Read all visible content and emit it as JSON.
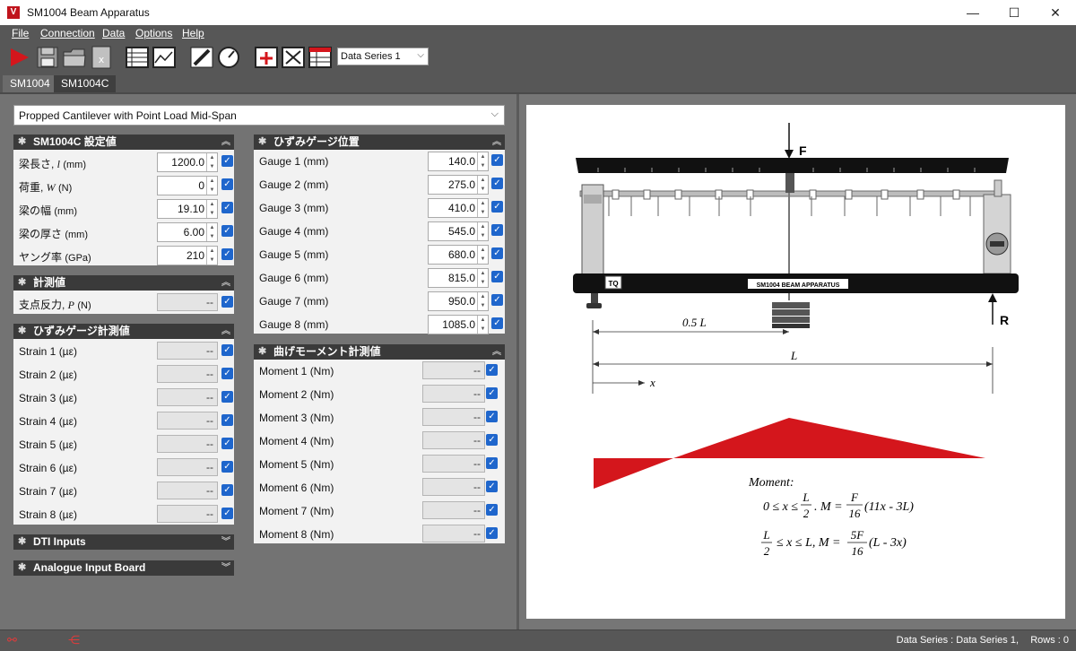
{
  "window": {
    "title": "SM1004 Beam Apparatus",
    "minimize": "—",
    "maximize": "☐",
    "close": "✕"
  },
  "menu": [
    "File",
    "Connection",
    "Data",
    "Options",
    "Help"
  ],
  "toolbar": {
    "series_select": "Data Series 1"
  },
  "tabs": [
    "SM1004",
    "SM1004C"
  ],
  "active_tab": "SM1004C",
  "config_select": "Propped Cantilever with Point Load Mid-Span",
  "settings": {
    "title": "SM1004C 設定値",
    "rows": [
      {
        "label": "梁長さ, ",
        "sym": "l",
        "unit": "(mm)",
        "value": "1200.0"
      },
      {
        "label": "荷重, ",
        "sym": "W",
        "unit": "(N)",
        "value": "0"
      },
      {
        "label": "梁の幅 ",
        "sym": "",
        "unit": "(mm)",
        "value": "19.10"
      },
      {
        "label": "梁の厚さ ",
        "sym": "",
        "unit": "(mm)",
        "value": "6.00"
      },
      {
        "label": "ヤング率 ",
        "sym": "",
        "unit": "(GPa)",
        "value": "210"
      }
    ]
  },
  "measured": {
    "title": "計測値",
    "rows": [
      {
        "label": "支点反力, ",
        "sym": "P",
        "unit": "(N)",
        "value": "--"
      }
    ]
  },
  "strain": {
    "title": "ひずみゲージ計測値",
    "rows": [
      {
        "label": "Strain 1 (µε)",
        "value": "--"
      },
      {
        "label": "Strain 2 (µε)",
        "value": "--"
      },
      {
        "label": "Strain 3 (µε)",
        "value": "--"
      },
      {
        "label": "Strain 4 (µε)",
        "value": "--"
      },
      {
        "label": "Strain 5 (µε)",
        "value": "--"
      },
      {
        "label": "Strain 6 (µε)",
        "value": "--"
      },
      {
        "label": "Strain 7 (µε)",
        "value": "--"
      },
      {
        "label": "Strain 8 (µε)",
        "value": "--"
      }
    ]
  },
  "dti": {
    "title": "DTI Inputs"
  },
  "analogue": {
    "title": "Analogue Input Board"
  },
  "gauge_pos": {
    "title": "ひずみゲージ位置",
    "rows": [
      {
        "label": "Gauge 1 (mm)",
        "value": "140.0"
      },
      {
        "label": "Gauge 2 (mm)",
        "value": "275.0"
      },
      {
        "label": "Gauge 3 (mm)",
        "value": "410.0"
      },
      {
        "label": "Gauge 4 (mm)",
        "value": "545.0"
      },
      {
        "label": "Gauge 5 (mm)",
        "value": "680.0"
      },
      {
        "label": "Gauge 6 (mm)",
        "value": "815.0"
      },
      {
        "label": "Gauge 7 (mm)",
        "value": "950.0"
      },
      {
        "label": "Gauge 8 (mm)",
        "value": "1085.0"
      }
    ]
  },
  "moment": {
    "title": "曲げモーメント計測値",
    "rows": [
      {
        "label": "Moment 1 (Nm)",
        "value": "--"
      },
      {
        "label": "Moment 2 (Nm)",
        "value": "--"
      },
      {
        "label": "Moment 3 (Nm)",
        "value": "--"
      },
      {
        "label": "Moment 4 (Nm)",
        "value": "--"
      },
      {
        "label": "Moment 5 (Nm)",
        "value": "--"
      },
      {
        "label": "Moment 6 (Nm)",
        "value": "--"
      },
      {
        "label": "Moment 7 (Nm)",
        "value": "--"
      },
      {
        "label": "Moment 8 (Nm)",
        "value": "--"
      }
    ]
  },
  "diagram": {
    "force_label": "F",
    "reaction_label": "R",
    "half_label": "0.5 L",
    "length_label": "L",
    "x_label": "x",
    "apparatus_plate": "SM1004 BEAM APPARATUS",
    "brand": "TQ",
    "moment_title": "Moment:",
    "eq1_range_a": "0 ≤ x ≤",
    "eq1_frac_num": "L",
    "eq1_frac_den": "2",
    "eq1_mid": ". M =",
    "eq1_coef_num": "F",
    "eq1_coef_den": "16",
    "eq1_tail": "(11x - 3L)",
    "eq2_frac_num": "L",
    "eq2_frac_den": "2",
    "eq2_range": "≤ x ≤ L,  M =",
    "eq2_coef_num": "5F",
    "eq2_coef_den": "16",
    "eq2_tail": "(L - 3x)",
    "accent": "#d4161c"
  },
  "status": {
    "series": "Data Series : Data Series 1,",
    "rows": "Rows : 0"
  }
}
